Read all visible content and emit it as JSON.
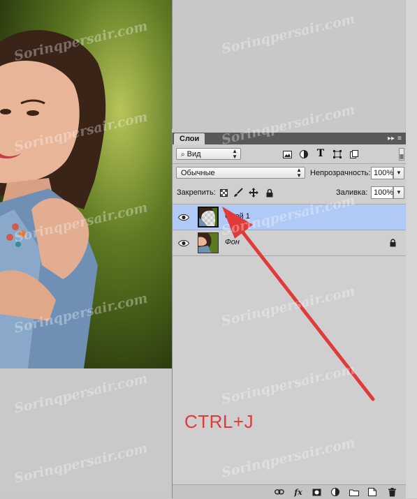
{
  "panel": {
    "tab_title": "Слои",
    "filter_kind": "Вид",
    "blend_mode": "Обычные",
    "opacity_label": "Непрозрачность:",
    "opacity_value": "100%",
    "lock_label": "Закрепить:",
    "fill_label": "Заливка:",
    "fill_value": "100%",
    "layers": [
      {
        "name": "Слой 1",
        "selected": true,
        "visible": true,
        "locked": false
      },
      {
        "name": "Фон",
        "selected": false,
        "visible": true,
        "locked": true
      }
    ]
  },
  "annotation": {
    "shortcut": "CTRL+J",
    "arrow_color": "#e03a3a"
  },
  "watermark": "Sorinqpersair.com",
  "colors": {
    "selected_layer": "#b1c9f5",
    "panel_bg": "#cfcfcf",
    "header_bg": "#595959"
  }
}
